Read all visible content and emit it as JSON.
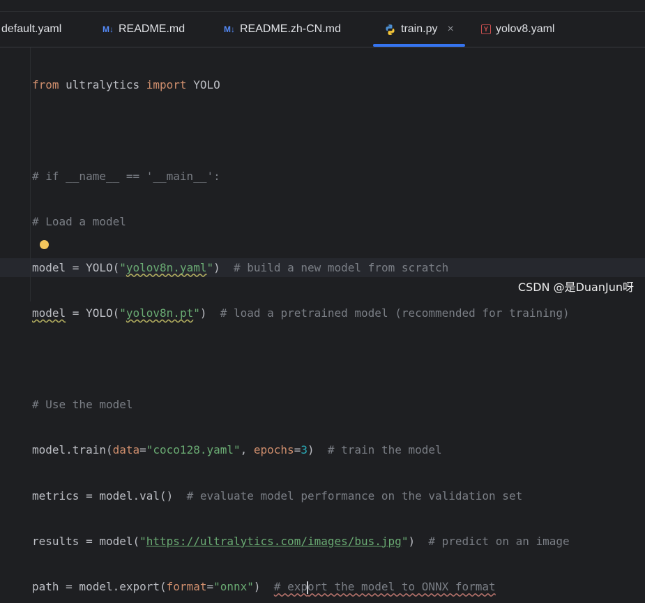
{
  "tabs": [
    {
      "label": "default.yaml",
      "icon": "yaml-file-icon"
    },
    {
      "label": "README.md",
      "icon": "markdown-file-icon",
      "icon_text": "M↓"
    },
    {
      "label": "README.zh-CN.md",
      "icon": "markdown-file-icon",
      "icon_text": "M↓"
    },
    {
      "label": "train.py",
      "icon": "python-file-icon",
      "active": true,
      "close": "×"
    },
    {
      "label": "yolov8.yaml",
      "icon": "yaml-file-icon",
      "icon_text": "Y"
    }
  ],
  "code": {
    "l1_kw1": "from",
    "l1_mid": " ultralytics ",
    "l1_kw2": "import",
    "l1_end": " YOLO",
    "l3": "# if __name__ == '__main__':",
    "l4": "# Load a model",
    "l5_pre": "model = YOLO(",
    "l5_str_q1": "\"",
    "l5_str": "yolov8n.yaml",
    "l5_str_q2": "\"",
    "l5_post": ")  ",
    "l5_cmt": "# build a new model from scratch",
    "l6_var": "model",
    "l6_pre": " = YOLO(",
    "l6_str_q1": "\"",
    "l6_str": "yolov8n.pt",
    "l6_str_q2": "\"",
    "l6_post": ")  ",
    "l6_cmt": "# load a pretrained model (recommended for training)",
    "l8": "# Use the model",
    "l9_pre": "model.train(",
    "l9_p1": "data",
    "l9_eq1": "=",
    "l9_s1": "\"coco128.yaml\"",
    "l9_sep": ", ",
    "l9_p2": "epochs",
    "l9_eq2": "=",
    "l9_n": "3",
    "l9_post": ")  ",
    "l9_cmt": "# train the model",
    "l10_pre": "metrics = model.val()  ",
    "l10_cmt": "# evaluate model performance on the validation set",
    "l11_pre": "results = model(",
    "l11_q1": "\"",
    "l11_url": "https://ultralytics.com/images/bus.jpg",
    "l11_q2": "\"",
    "l11_post": ")  ",
    "l11_cmt": "# predict on an image",
    "l12_pre": "path = model.export(",
    "l12_p": "format",
    "l12_eq": "=",
    "l12_s": "\"onnx\"",
    "l12_post": ")  ",
    "l12_cmt_a": "# exp",
    "l12_cmt_b": "ort the model to ONNX format"
  },
  "watermark": "CSDN @是DuanJun呀",
  "colors": {
    "background": "#1e1f22",
    "keyword": "#cf8e6d",
    "string": "#6aab73",
    "comment": "#7a7e85",
    "number": "#2aacb8",
    "active_tab_underline": "#3574f0"
  }
}
